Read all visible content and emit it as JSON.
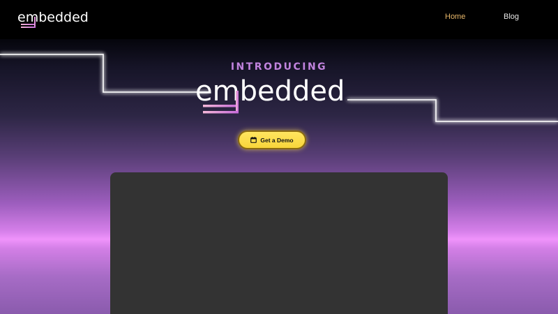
{
  "brand": {
    "name": "embedded",
    "text_color": "#ffffff",
    "accent_gradient": [
      "#f5b8d8",
      "#c66ad9"
    ]
  },
  "nav": {
    "items": [
      {
        "label": "Home",
        "active": true,
        "color": "#e9b86a"
      },
      {
        "label": "Blog",
        "active": false,
        "color": "#e8e8e8"
      }
    ]
  },
  "hero": {
    "eyebrow": "INTRODUCING",
    "eyebrow_color": "#c183de",
    "title": "embedded",
    "cta": {
      "label": "Get a Demo",
      "icon": "calendar-icon",
      "color": "#f8d53a"
    }
  },
  "colors": {
    "page_background": "#000000",
    "glow_band": "#ef93fb",
    "panel": "#333333",
    "neon_line": "#ffffff"
  }
}
